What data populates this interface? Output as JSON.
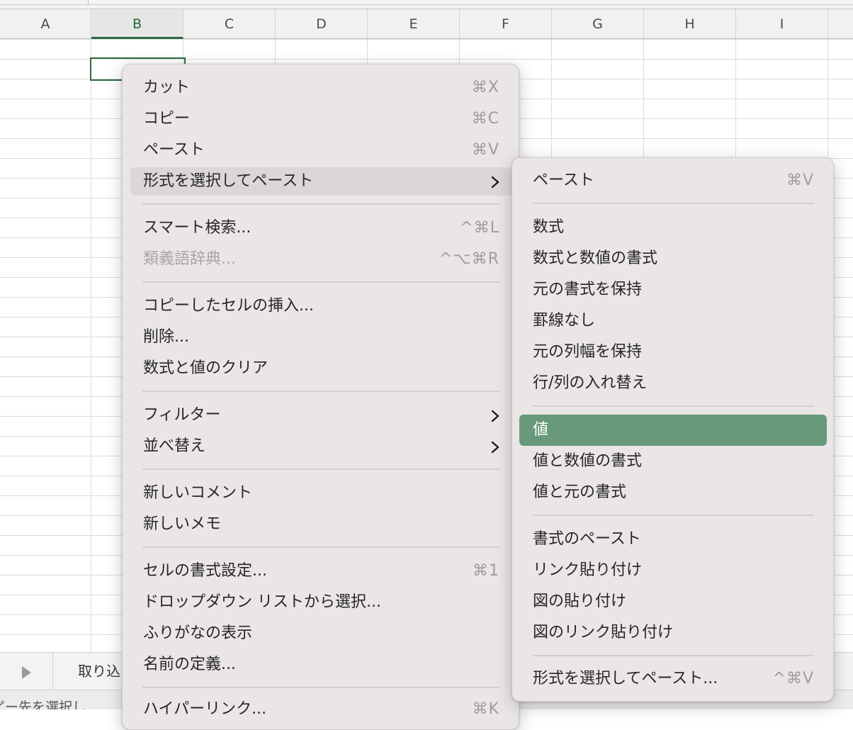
{
  "spreadsheet": {
    "columns": [
      "A",
      "B",
      "C",
      "D",
      "E",
      "F",
      "G",
      "H",
      "I"
    ],
    "active_column": "B",
    "sheet_tab_label": "取り込",
    "status_text": "ピー先を選択し"
  },
  "context_menu": {
    "items": [
      {
        "label": "カット",
        "shortcut": "⌘X"
      },
      {
        "label": "コピー",
        "shortcut": "⌘C"
      },
      {
        "label": "ペースト",
        "shortcut": "⌘V"
      },
      {
        "label": "形式を選択してペースト",
        "has_submenu": true,
        "state": "hover"
      },
      {
        "label": "スマート検索...",
        "shortcut": "^⌘L"
      },
      {
        "label": "類義語辞典...",
        "shortcut": "^⌥⌘R",
        "state": "disabled"
      },
      {
        "label": "コピーしたセルの挿入..."
      },
      {
        "label": "削除..."
      },
      {
        "label": "数式と値のクリア"
      },
      {
        "label": "フィルター",
        "has_submenu": true
      },
      {
        "label": "並べ替え",
        "has_submenu": true
      },
      {
        "label": "新しいコメント"
      },
      {
        "label": "新しいメモ"
      },
      {
        "label": "セルの書式設定...",
        "shortcut": "⌘1"
      },
      {
        "label": "ドロップダウン リストから選択..."
      },
      {
        "label": "ふりがなの表示"
      },
      {
        "label": "名前の定義..."
      },
      {
        "label": "ハイパーリンク...",
        "shortcut": "⌘K"
      }
    ]
  },
  "paste_special_submenu": {
    "items": [
      {
        "label": "ペースト",
        "shortcut": "⌘V"
      },
      {
        "label": "数式"
      },
      {
        "label": "数式と数値の書式"
      },
      {
        "label": "元の書式を保持"
      },
      {
        "label": "罫線なし"
      },
      {
        "label": "元の列幅を保持"
      },
      {
        "label": "行/列の入れ替え"
      },
      {
        "label": "値",
        "state": "selected"
      },
      {
        "label": "値と数値の書式"
      },
      {
        "label": "値と元の書式"
      },
      {
        "label": "書式のペースト"
      },
      {
        "label": "リンク貼り付け"
      },
      {
        "label": "図の貼り付け"
      },
      {
        "label": "図のリンク貼り付け"
      },
      {
        "label": "形式を選択してペースト...",
        "shortcut": "^⌘V"
      }
    ]
  },
  "colors": {
    "accent_selected": "#67997a",
    "active_cell_border": "#2d6b3f",
    "menu_background": "#ebe6e6"
  }
}
